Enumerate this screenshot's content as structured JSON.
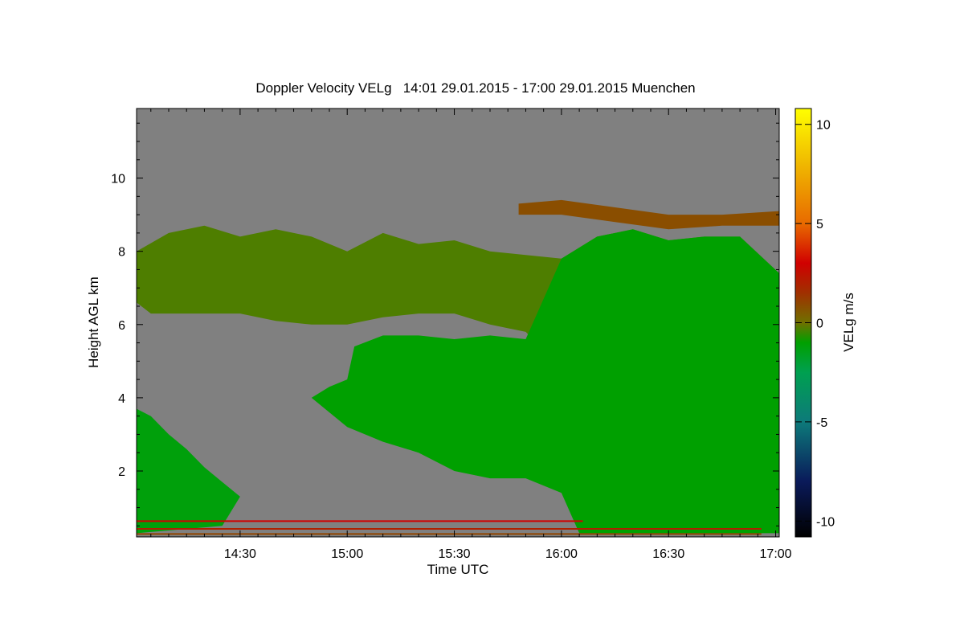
{
  "chart_data": {
    "type": "heatmap",
    "title": "Doppler Velocity VELg   14:01 29.01.2015 - 17:00 29.01.2015 Muenchen",
    "xlabel": "Time UTC",
    "ylabel": "Height AGL km",
    "x_range_min": [
      841,
      1021
    ],
    "y_range_km": [
      0.2,
      11.9
    ],
    "x_ticks": [
      {
        "min": 870,
        "label": "14:30"
      },
      {
        "min": 900,
        "label": "15:00"
      },
      {
        "min": 930,
        "label": "15:30"
      },
      {
        "min": 960,
        "label": "16:00"
      },
      {
        "min": 990,
        "label": "16:30"
      },
      {
        "min": 1020,
        "label": "17:00"
      }
    ],
    "y_ticks": [
      {
        "km": 2,
        "label": "2"
      },
      {
        "km": 4,
        "label": "4"
      },
      {
        "km": 6,
        "label": "6"
      },
      {
        "km": 8,
        "label": "8"
      },
      {
        "km": 10,
        "label": "10"
      }
    ],
    "no_signal_color": "#808080",
    "colorbar": {
      "label": "VELg m/s",
      "range": [
        -10.8,
        10.8
      ],
      "ticks": [
        {
          "value": 10,
          "label": "10"
        },
        {
          "value": 5,
          "label": "5"
        },
        {
          "value": 0,
          "label": "0"
        },
        {
          "value": -5,
          "label": "-5"
        },
        {
          "value": -10,
          "label": "-10"
        }
      ],
      "stops": [
        {
          "value": -10.8,
          "color": "#000000"
        },
        {
          "value": -8,
          "color": "#0a1a5a"
        },
        {
          "value": -5,
          "color": "#0d7a7a"
        },
        {
          "value": -2.5,
          "color": "#00a050"
        },
        {
          "value": -1,
          "color": "#00a000"
        },
        {
          "value": 0,
          "color": "#707000"
        },
        {
          "value": 1.5,
          "color": "#a03000"
        },
        {
          "value": 3,
          "color": "#d00000"
        },
        {
          "value": 5,
          "color": "#e86a00"
        },
        {
          "value": 8,
          "color": "#f0b800"
        },
        {
          "value": 10.8,
          "color": "#ffff00"
        }
      ]
    },
    "echo_regions": [
      {
        "name": "upper cirrus layer",
        "velocity_mps": -0.3,
        "top": [
          [
            841,
            8.0
          ],
          [
            850,
            8.5
          ],
          [
            860,
            8.7
          ],
          [
            870,
            8.4
          ],
          [
            880,
            8.6
          ],
          [
            890,
            8.4
          ],
          [
            900,
            8.0
          ],
          [
            910,
            8.5
          ],
          [
            920,
            8.2
          ],
          [
            930,
            8.3
          ],
          [
            940,
            8.0
          ],
          [
            950,
            7.9
          ],
          [
            960,
            7.8
          ],
          [
            970,
            8.4
          ],
          [
            980,
            8.6
          ],
          [
            990,
            8.3
          ],
          [
            1000,
            8.4
          ],
          [
            1010,
            8.4
          ],
          [
            1021,
            7.4
          ]
        ],
        "bottom": [
          [
            841,
            6.6
          ],
          [
            845,
            6.3
          ],
          [
            860,
            6.3
          ],
          [
            870,
            6.3
          ],
          [
            880,
            6.1
          ],
          [
            890,
            6.0
          ],
          [
            900,
            6.0
          ],
          [
            910,
            6.2
          ],
          [
            920,
            6.3
          ],
          [
            930,
            6.3
          ],
          [
            940,
            6.0
          ],
          [
            950,
            5.8
          ],
          [
            960,
            4.8
          ],
          [
            1021,
            4.8
          ]
        ]
      },
      {
        "name": "main precipitation body",
        "velocity_mps": -1.0,
        "top": [
          [
            890,
            4.0
          ],
          [
            895,
            4.3
          ],
          [
            900,
            4.5
          ],
          [
            902,
            5.4
          ],
          [
            910,
            5.7
          ],
          [
            920,
            5.7
          ],
          [
            930,
            5.6
          ],
          [
            940,
            5.7
          ],
          [
            950,
            5.6
          ],
          [
            960,
            7.8
          ],
          [
            970,
            8.4
          ],
          [
            980,
            8.6
          ],
          [
            990,
            8.3
          ],
          [
            1000,
            8.4
          ],
          [
            1010,
            8.4
          ],
          [
            1021,
            7.4
          ]
        ],
        "bottom": [
          [
            890,
            4.0
          ],
          [
            900,
            3.2
          ],
          [
            910,
            2.8
          ],
          [
            920,
            2.5
          ],
          [
            930,
            2.0
          ],
          [
            940,
            1.8
          ],
          [
            950,
            1.8
          ],
          [
            960,
            1.4
          ],
          [
            965,
            0.3
          ],
          [
            1021,
            0.3
          ]
        ]
      },
      {
        "name": "low-level echo",
        "velocity_mps": -1.2,
        "top": [
          [
            841,
            3.7
          ],
          [
            845,
            3.5
          ],
          [
            850,
            3.0
          ],
          [
            855,
            2.6
          ],
          [
            860,
            2.1
          ],
          [
            865,
            1.7
          ],
          [
            870,
            1.3
          ],
          [
            865,
            0.5
          ],
          [
            841,
            0.3
          ]
        ],
        "bottom": [
          [
            841,
            0.3
          ],
          [
            870,
            0.3
          ]
        ]
      },
      {
        "name": "upper fall streak",
        "velocity_mps": 0.8,
        "top": [
          [
            948,
            9.3
          ],
          [
            960,
            9.4
          ],
          [
            975,
            9.2
          ],
          [
            990,
            9.0
          ],
          [
            1005,
            9.0
          ],
          [
            1021,
            9.1
          ]
        ],
        "bottom": [
          [
            948,
            9.0
          ],
          [
            960,
            9.0
          ],
          [
            975,
            8.8
          ],
          [
            990,
            8.6
          ],
          [
            1005,
            8.7
          ],
          [
            1021,
            8.7
          ]
        ]
      }
    ],
    "near_ground_lines": [
      {
        "km": 0.63,
        "x_from": 841,
        "x_to": 966,
        "velocity_mps": 3.0
      },
      {
        "km": 0.42,
        "x_from": 841,
        "x_to": 1016,
        "velocity_mps": 2.0
      },
      {
        "km": 0.28,
        "x_from": 841,
        "x_to": 1016,
        "velocity_mps": 1.0
      }
    ]
  }
}
